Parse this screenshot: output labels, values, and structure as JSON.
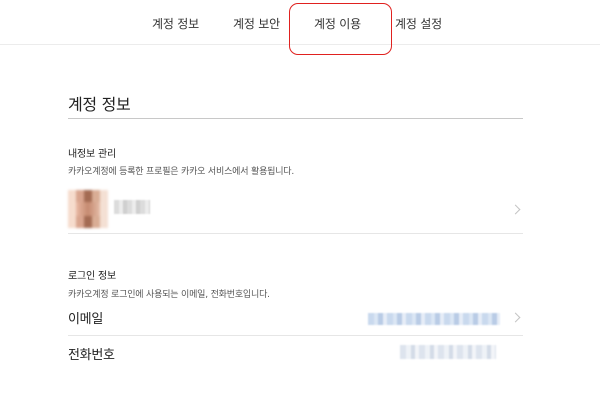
{
  "nav": {
    "tabs": [
      {
        "label": "계정 정보"
      },
      {
        "label": "계정 보안"
      },
      {
        "label": "계정 이용"
      },
      {
        "label": "계정 설정"
      }
    ],
    "highlight_color": "#e0211f"
  },
  "section": {
    "title": "계정 정보"
  },
  "profile": {
    "heading": "내정보 관리",
    "description": "카카오계정에 등록한 프로필은 카카오 서비스에서 활용됩니다."
  },
  "login": {
    "heading": "로그인 정보",
    "description": "카카오계정 로그인에 사용되는 이메일, 전화번호입니다.",
    "email_label": "이메일",
    "phone_label": "전화번호"
  }
}
